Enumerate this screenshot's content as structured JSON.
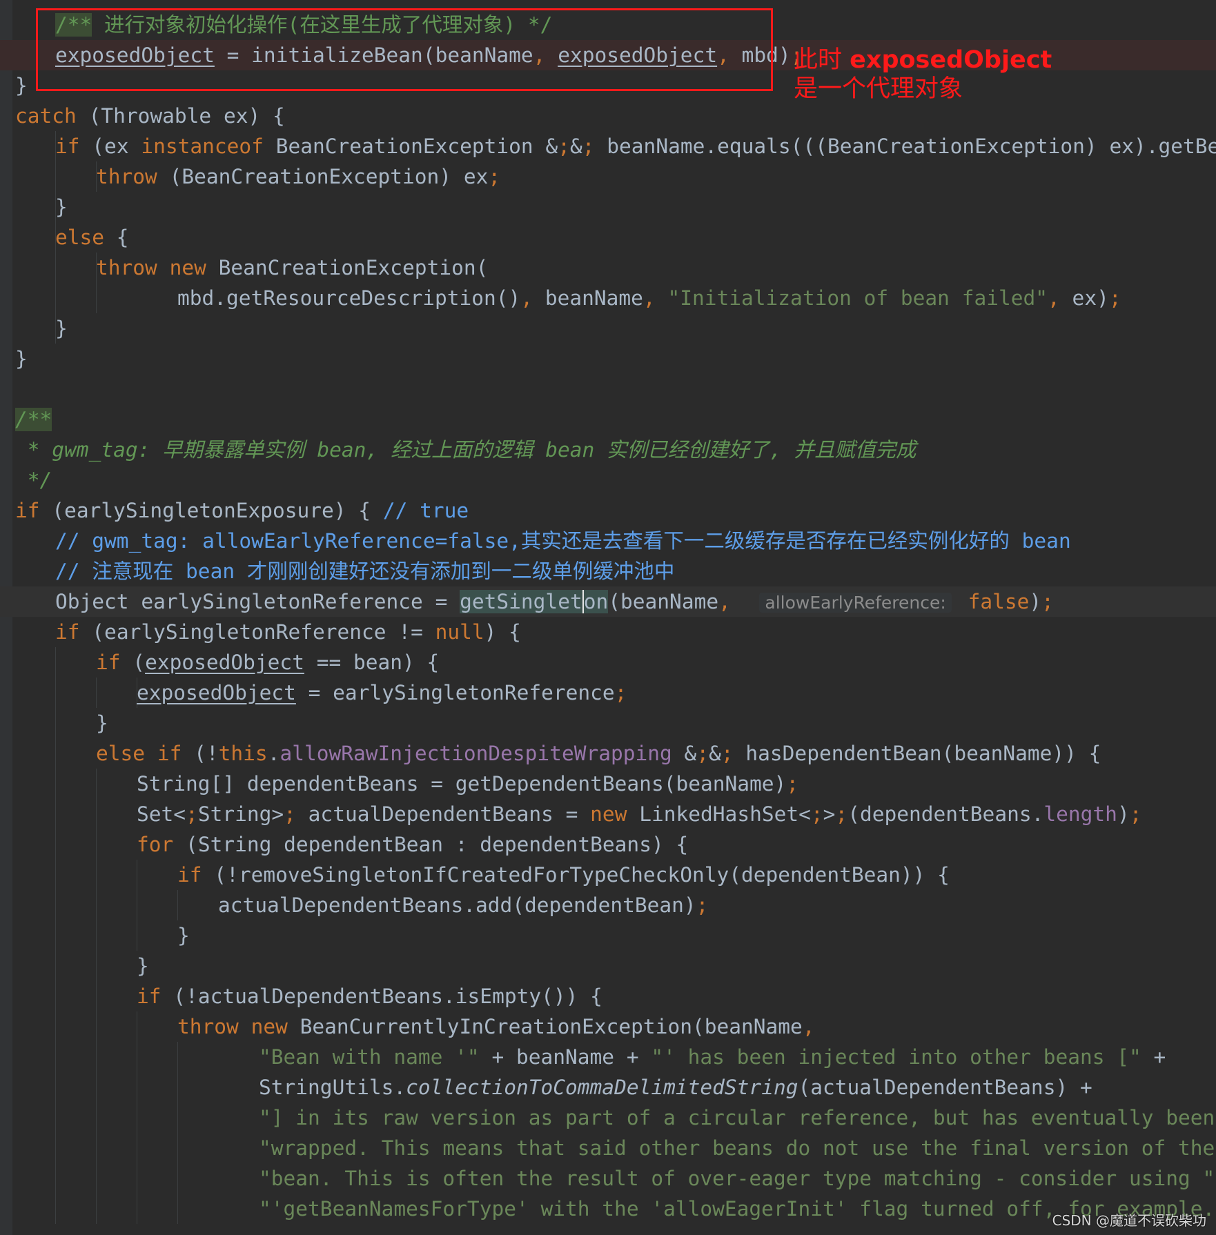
{
  "code_lines": [
    "/** 进行对象初始化操作(在这里生成了代理对象) */",
    "exposedObject = initializeBean(beanName, exposedObject, mbd);",
    "}",
    "catch (Throwable ex) {",
    "if (ex instanceof BeanCreationException && beanName.equals(((BeanCreationException) ex).getBeanName(",
    "throw (BeanCreationException) ex;",
    "}",
    "else {",
    "throw new BeanCreationException(",
    "mbd.getResourceDescription(), beanName, \"Initialization of bean failed\", ex);",
    "}",
    "}",
    "",
    "/**",
    " * gwm_tag: 早期暴露单实例 bean, 经过上面的逻辑 bean 实例已经创建好了, 并且赋值完成",
    " */",
    "if (earlySingletonExposure) { // true",
    "// gwm_tag: allowEarlyReference=false,其实还是去查看下一二级缓存是否存在已经实例化好的 bean",
    "// 注意现在 bean 才刚刚创建好还没有添加到一二级单例缓冲池中",
    "Object earlySingletonReference = getSingleton(beanName,  allowEarlyReference: false);",
    "if (earlySingletonReference != null) {",
    "if (exposedObject == bean) {",
    "exposedObject = earlySingletonReference;",
    "}",
    "else if (!this.allowRawInjectionDespiteWrapping && hasDependentBean(beanName)) {",
    "String[] dependentBeans = getDependentBeans(beanName);",
    "Set<String> actualDependentBeans = new LinkedHashSet<>(dependentBeans.length);",
    "for (String dependentBean : dependentBeans) {",
    "if (!removeSingletonIfCreatedForTypeCheckOnly(dependentBean)) {",
    "actualDependentBeans.add(dependentBean);",
    "}",
    "}",
    "if (!actualDependentBeans.isEmpty()) {",
    "throw new BeanCurrentlyInCreationException(beanName,",
    "\"Bean with name '\" + beanName + \"' has been injected into other beans [\" +",
    "StringUtils.collectionToCommaDelimitedString(actualDependentBeans) +",
    "\"] in its raw version as part of a circular reference, but has eventually been \"",
    "\"wrapped. This means that said other beans do not use the final version of the \"",
    "\"bean. This is often the result of over-eager type matching - consider using \" +",
    "\"'getBeanNamesForType' with the 'allowEagerInit' flag turned off, for example.\");"
  ],
  "annotation": {
    "line1_prefix": "此时 ",
    "line1_bold": "exposedObject",
    "line2": "是一个代理对象"
  },
  "watermark": "CSDN @魔道不误砍柴功",
  "colors": {
    "background": "#2b2b2b",
    "keyword": "#cc7832",
    "string": "#6a8759",
    "doc_comment": "#629755",
    "line_comment": "#5d9ee8",
    "field": "#9876aa",
    "annotation_red": "#ff1a1a"
  }
}
